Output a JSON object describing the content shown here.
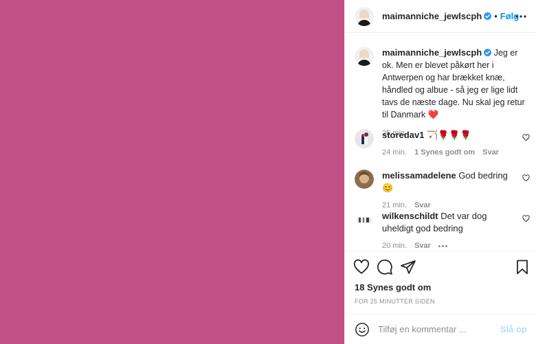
{
  "colors": {
    "media_background": "#c25188",
    "link_blue": "#0095f6",
    "verified_blue": "#3897f0",
    "like_heart_red": "#ed4956",
    "muted_text": "#8e8e8e",
    "disabled_post": "#b2dffc"
  },
  "header": {
    "username": "maimanniche_jewlscph",
    "separator": "•",
    "follow_label": "Følg",
    "more_icon": "more-horizontal-icon",
    "verified_icon": "verified-badge-icon"
  },
  "caption": {
    "username": "maimanniche_jewlscph",
    "text": "Jeg er ok. Men er blevet påkørt her i Antwerpen og har brækket knæ, håndled og albue - så jeg er lige lidt tavs de næste dage. Nu skal jeg retur til Danmark ❤️",
    "time": "25 min."
  },
  "comments": [
    {
      "username": "storedav1",
      "text": "🏹🌹🌹🌹",
      "time": "24 min.",
      "likes_label": "1 Synes godt om",
      "reply_label": "Svar"
    },
    {
      "username": "melissamadelene",
      "text": "God bedring 😊",
      "time": "21 min.",
      "reply_label": "Svar"
    },
    {
      "username": "wilkenschildt",
      "text": "Det var dog uheldigt god bedring",
      "time": "20 min.",
      "reply_label": "Svar"
    }
  ],
  "actions": {
    "like_icon": "heart-outline-icon",
    "comment_icon": "comment-bubble-icon",
    "share_icon": "paper-plane-icon",
    "save_icon": "bookmark-icon"
  },
  "likes_text": "18 Synes godt om",
  "posted_ago": "FOR 25 MINUTTER SIDEN",
  "composer": {
    "placeholder": "Tilføj en kommentar ...",
    "post_label": "Slå op",
    "emoji_icon": "smiley-icon"
  }
}
